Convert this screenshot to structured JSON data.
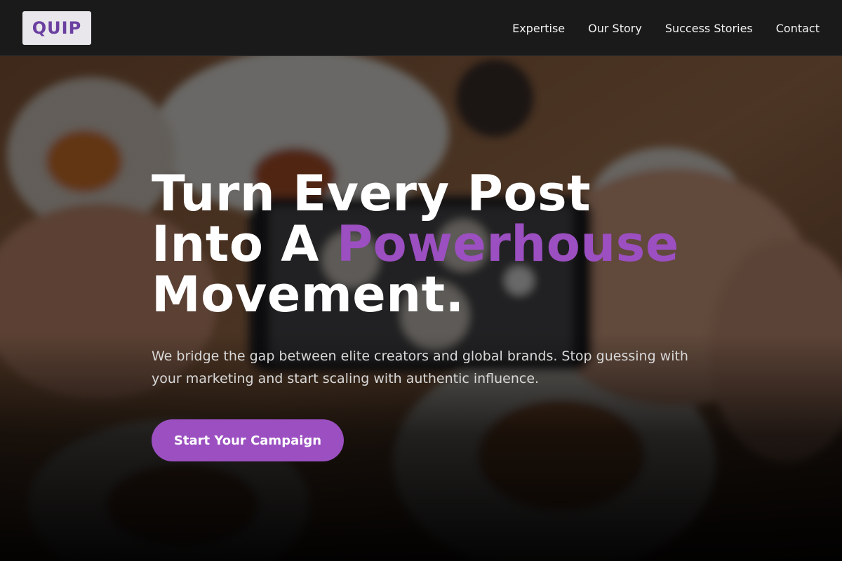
{
  "header": {
    "logo": "QUIP",
    "nav": [
      {
        "label": "Expertise"
      },
      {
        "label": "Our Story"
      },
      {
        "label": "Success Stories"
      },
      {
        "label": "Contact"
      }
    ]
  },
  "hero": {
    "headline_line1": "Turn Every Post",
    "headline_line2_prefix": "Into A ",
    "headline_accent": "Powerhouse",
    "headline_line3": "Movement.",
    "subtext": "We bridge the gap between elite creators and global brands. Stop guessing with your marketing and start scaling with authentic influence.",
    "cta_label": "Start Your Campaign"
  },
  "colors": {
    "accent": "#9b4fc0",
    "header_bg": "#1a1a1a",
    "logo_bg": "#e9e7ec",
    "logo_text": "#6b3fa0"
  }
}
